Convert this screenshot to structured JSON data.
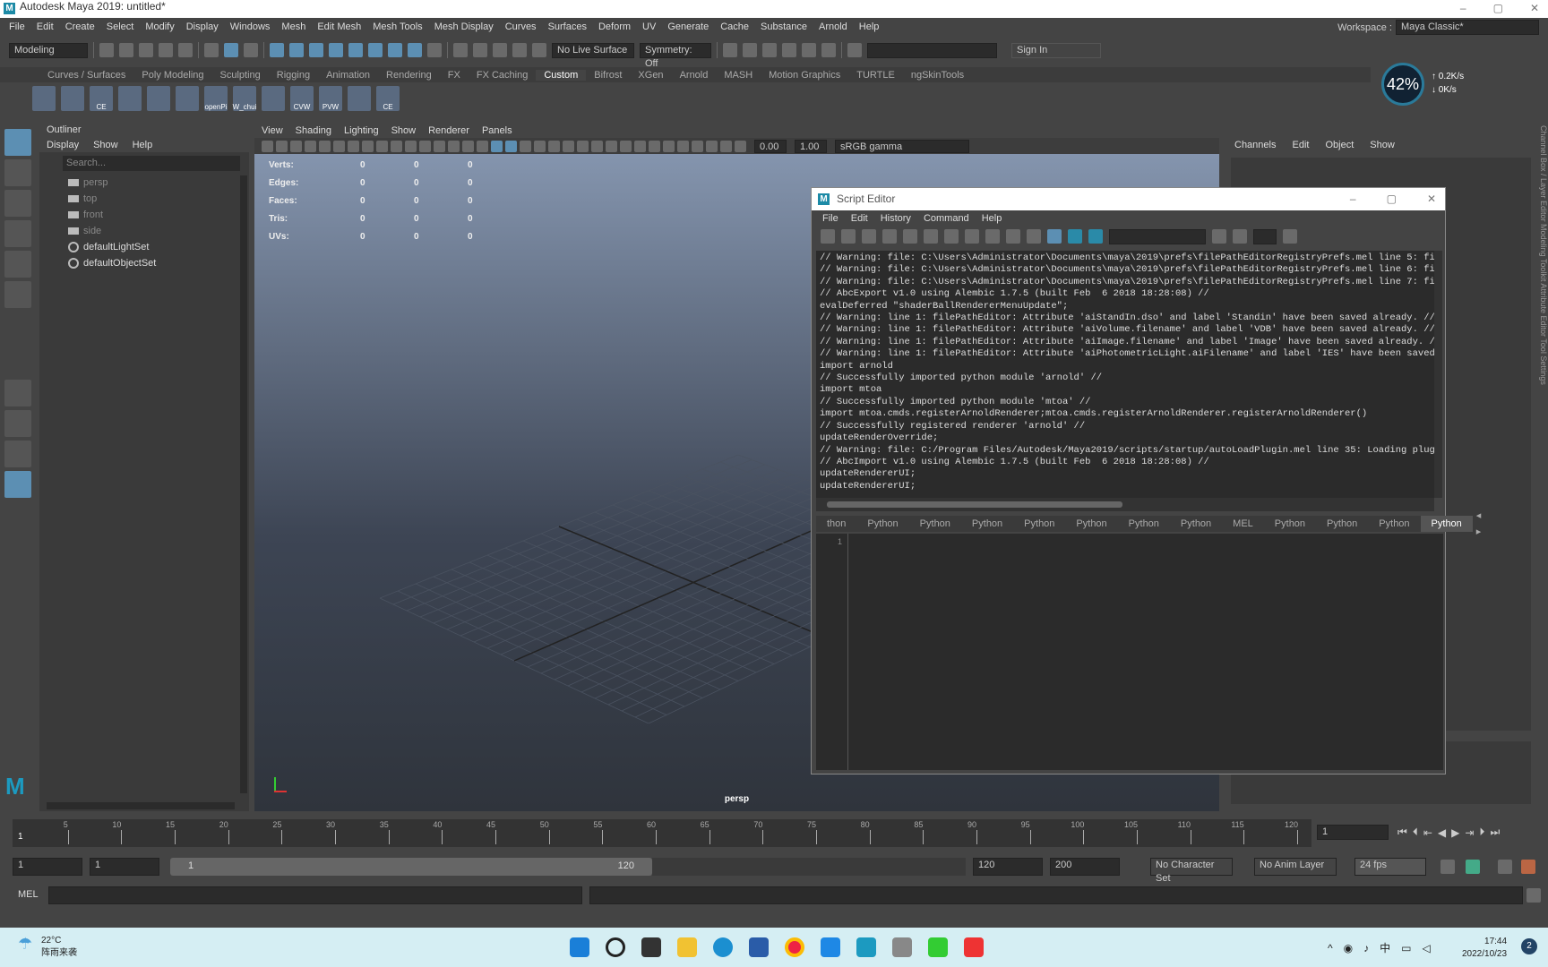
{
  "window": {
    "title": "Autodesk Maya 2019: untitled*",
    "logo": "M",
    "controls": [
      "–",
      "▢",
      "✕"
    ]
  },
  "menubar": [
    "File",
    "Edit",
    "Create",
    "Select",
    "Modify",
    "Display",
    "Windows",
    "Mesh",
    "Edit Mesh",
    "Mesh Tools",
    "Mesh Display",
    "Curves",
    "Surfaces",
    "Deform",
    "UV",
    "Generate",
    "Cache",
    "Substance",
    "Arnold",
    "Help"
  ],
  "workspace": {
    "label": "Workspace :",
    "value": "Maya Classic*"
  },
  "toolbar": {
    "mode": "Modeling",
    "live_surface": "No Live Surface",
    "symmetry": "Symmetry: Off",
    "sign_in": "Sign In"
  },
  "shelf": {
    "tabs": [
      "Curves / Surfaces",
      "Poly Modeling",
      "Sculpting",
      "Rigging",
      "Animation",
      "Rendering",
      "FX",
      "FX Caching",
      "Custom",
      "Bifrost",
      "XGen",
      "Arnold",
      "MASH",
      "Motion Graphics",
      "TURTLE",
      "ngSkinTools"
    ],
    "active": "Custom",
    "icons": [
      "",
      "",
      "CE",
      "",
      "",
      "",
      "openPi",
      "W_chui",
      "",
      "CVW",
      "PVW",
      "",
      "CE"
    ]
  },
  "network": {
    "percent": "42%",
    "up": "0.2K/s",
    "down": "0K/s"
  },
  "outliner": {
    "tab": "Outliner",
    "menu": [
      "Display",
      "Show",
      "Help"
    ],
    "search_placeholder": "Search...",
    "items": [
      {
        "label": "persp",
        "type": "camera"
      },
      {
        "label": "top",
        "type": "camera"
      },
      {
        "label": "front",
        "type": "camera"
      },
      {
        "label": "side",
        "type": "camera"
      },
      {
        "label": "defaultLightSet",
        "type": "set"
      },
      {
        "label": "defaultObjectSet",
        "type": "set"
      }
    ]
  },
  "viewport": {
    "menu": [
      "View",
      "Shading",
      "Lighting",
      "Show",
      "Renderer",
      "Panels"
    ],
    "exposure": "0.00",
    "gamma": "1.00",
    "color_space": "sRGB gamma",
    "hud": [
      [
        "Verts:",
        "0",
        "0",
        "0"
      ],
      [
        "Edges:",
        "0",
        "0",
        "0"
      ],
      [
        "Faces:",
        "0",
        "0",
        "0"
      ],
      [
        "Tris:",
        "0",
        "0",
        "0"
      ],
      [
        "UVs:",
        "0",
        "0",
        "0"
      ]
    ],
    "camera": "persp"
  },
  "channel_box": {
    "menu": [
      "Channels",
      "Edit",
      "Object",
      "Show"
    ],
    "side_tabs": "Channel Box / Layer Editor   Modeling Toolkit   Attribute Editor   Tool Settings"
  },
  "script_editor": {
    "title": "Script Editor",
    "menu": [
      "File",
      "Edit",
      "History",
      "Command",
      "Help"
    ],
    "history": [
      "// Warning: file: C:\\Users\\Administrator\\Documents\\maya\\2019\\prefs\\filePathEditorRegistryPrefs.mel line 5: fi",
      "// Warning: file: C:\\Users\\Administrator\\Documents\\maya\\2019\\prefs\\filePathEditorRegistryPrefs.mel line 6: fi",
      "// Warning: file: C:\\Users\\Administrator\\Documents\\maya\\2019\\prefs\\filePathEditorRegistryPrefs.mel line 7: fi",
      "// AbcExport v1.0 using Alembic 1.7.5 (built Feb  6 2018 18:28:08) //",
      "evalDeferred \"shaderBallRendererMenuUpdate\";",
      "// Warning: line 1: filePathEditor: Attribute 'aiStandIn.dso' and label 'Standin' have been saved already. //",
      "// Warning: line 1: filePathEditor: Attribute 'aiVolume.filename' and label 'VDB' have been saved already. //",
      "// Warning: line 1: filePathEditor: Attribute 'aiImage.filename' and label 'Image' have been saved already. /",
      "// Warning: line 1: filePathEditor: Attribute 'aiPhotometricLight.aiFilename' and label 'IES' have been saved",
      "import arnold",
      "// Successfully imported python module 'arnold' //",
      "import mtoa",
      "// Successfully imported python module 'mtoa' //",
      "import mtoa.cmds.registerArnoldRenderer;mtoa.cmds.registerArnoldRenderer.registerArnoldRenderer()",
      "// Successfully registered renderer 'arnold' //",
      "updateRenderOverride;",
      "// Warning: file: C:/Program Files/Autodesk/Maya2019/scripts/startup/autoLoadPlugin.mel line 35: Loading plug-",
      "// AbcImport v1.0 using Alembic 1.7.5 (built Feb  6 2018 18:28:08) //",
      "updateRendererUI;",
      "updateRendererUI;"
    ],
    "tabs": [
      "thon",
      "Python",
      "Python",
      "Python",
      "Python",
      "Python",
      "Python",
      "Python",
      "MEL",
      "Python",
      "Python",
      "Python",
      "Python"
    ],
    "active_tab": 12,
    "line_number": "1"
  },
  "timeline": {
    "ticks": [
      "5",
      "10",
      "15",
      "20",
      "25",
      "30",
      "35",
      "40",
      "45",
      "50",
      "55",
      "60",
      "65",
      "70",
      "75",
      "80",
      "85",
      "90",
      "95",
      "100",
      "105",
      "110",
      "115",
      "120"
    ],
    "start_marker": "1",
    "current_frame": "1"
  },
  "range": {
    "start": "1",
    "playback_start": "1",
    "slider_start": "1",
    "slider_end": "120",
    "playback_end": "120",
    "end": "200",
    "character_set": "No Character Set",
    "anim_layer": "No Anim Layer",
    "fps": "24 fps"
  },
  "command_line": {
    "language": "MEL"
  },
  "taskbar": {
    "weather_temp": "22°C",
    "weather_desc": "阵雨来袭",
    "time": "17:44",
    "date": "2022/10/23",
    "notifications": "2",
    "ime": "中"
  }
}
